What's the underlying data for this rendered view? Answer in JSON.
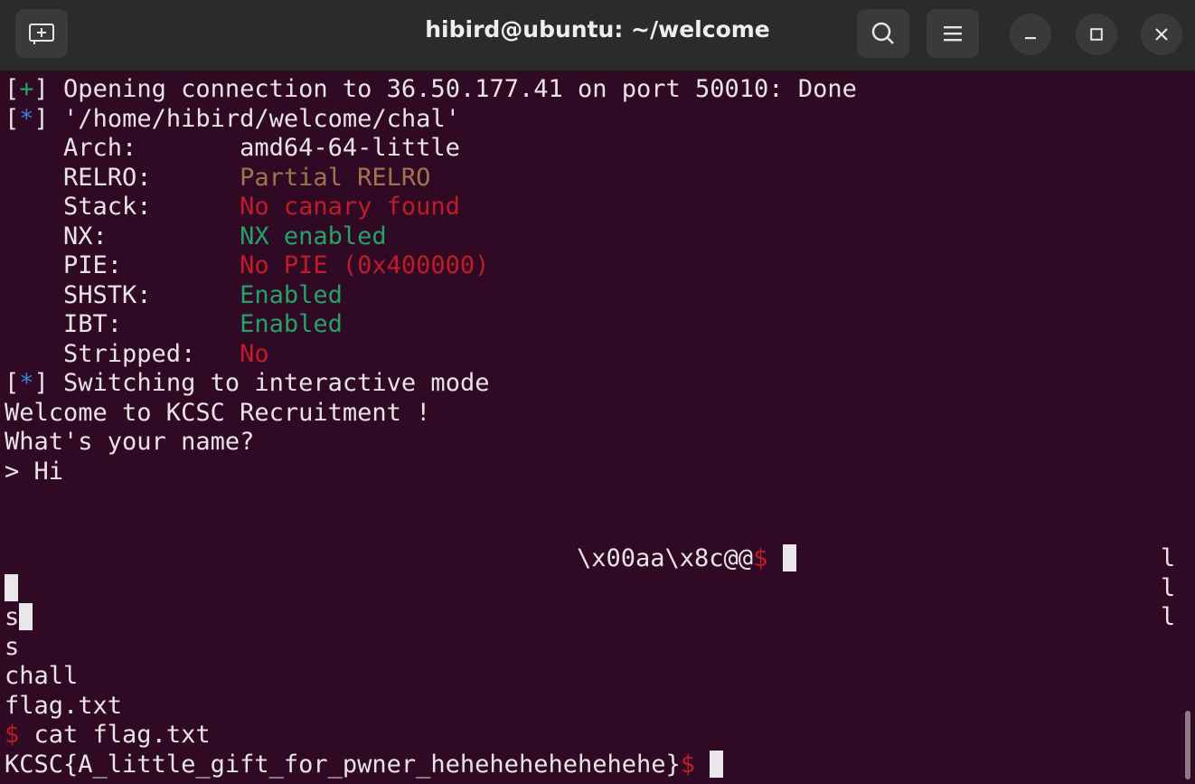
{
  "window": {
    "title": "hibird@ubuntu: ~/welcome",
    "new_tab_icon": "new-tab-icon",
    "search_icon": "search-icon",
    "menu_icon": "hamburger-menu-icon",
    "minimize_icon": "minimize-icon",
    "maximize_icon": "maximize-icon",
    "close_icon": "close-icon"
  },
  "colors": {
    "background": "#300a24",
    "green": "#26a269",
    "blue": "#3d7fd4",
    "red": "#c01c28",
    "yellow": "#a2734c",
    "text": "#e8e3e6"
  },
  "terminal": {
    "conn": {
      "open": "[",
      "mark": "+",
      "close": "]",
      "text": " Opening connection to 36.50.177.41 on port 50010: Done"
    },
    "file": {
      "open": "[",
      "mark": "*",
      "close": "]",
      "text": " '/home/hibird/welcome/chal'"
    },
    "checksec": [
      {
        "key": "    Arch:       ",
        "value": "amd64-64-little",
        "color": "text"
      },
      {
        "key": "    RELRO:      ",
        "value": "Partial RELRO",
        "color": "yellow"
      },
      {
        "key": "    Stack:      ",
        "value": "No canary found",
        "color": "red"
      },
      {
        "key": "    NX:         ",
        "value": "NX enabled",
        "color": "green"
      },
      {
        "key": "    PIE:        ",
        "value": "No PIE (0x400000)",
        "color": "red"
      },
      {
        "key": "    SHSTK:      ",
        "value": "Enabled",
        "color": "green"
      },
      {
        "key": "    IBT:        ",
        "value": "Enabled",
        "color": "green"
      },
      {
        "key": "    Stripped:   ",
        "value": "No",
        "color": "red"
      }
    ],
    "switch": {
      "open": "[",
      "mark": "*",
      "close": "]",
      "text": " Switching to interactive mode"
    },
    "welcome": "Welcome to KCSC Recruitment !",
    "ask": "What's your name?",
    "input": "> Hi",
    "leak": "\\x00aa\\x8c@@",
    "dollar": "$",
    "side_l": [
      "l",
      "l",
      "l"
    ],
    "s1": "s",
    "s2": "s",
    "ls1": "chall",
    "ls2": "flag.txt",
    "cmd": " cat flag.txt",
    "flag": "KCSC{A_little_gift_for_pwner_hehehehehehehehe}"
  }
}
